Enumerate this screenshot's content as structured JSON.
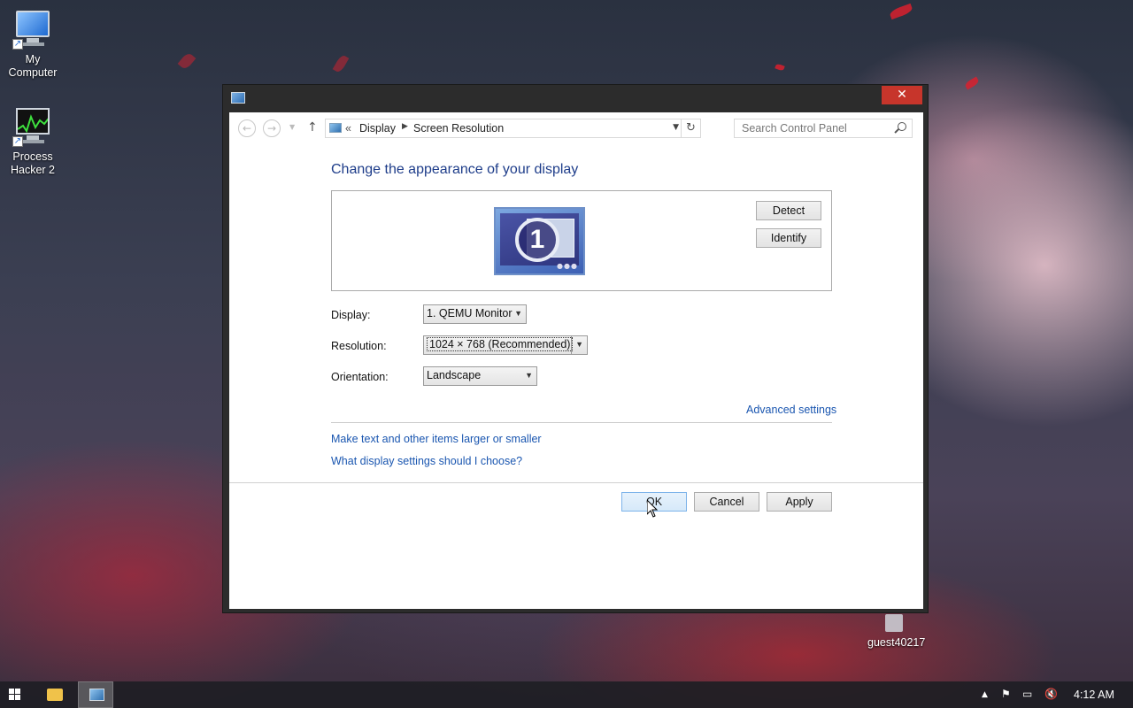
{
  "desktop": {
    "icons": [
      {
        "label_line1": "My",
        "label_line2": "Computer"
      },
      {
        "label_line1": "Process",
        "label_line2": "Hacker 2"
      }
    ],
    "user_label": "guest40217"
  },
  "window": {
    "close_label": "✕",
    "nav": {
      "back_label": "←",
      "forward_label": "→",
      "up_label": "↑",
      "breadcrumb_prefix": "«",
      "breadcrumb": [
        "Display",
        "Screen Resolution"
      ],
      "refresh_label": "↻",
      "search_placeholder": "Search Control Panel"
    },
    "heading": "Change the appearance of your display",
    "monitor_number": "1",
    "detect_label": "Detect",
    "identify_label": "Identify",
    "fields": {
      "display": {
        "label": "Display:",
        "value": "1. QEMU Monitor"
      },
      "resolution": {
        "label": "Resolution:",
        "value": "1024 × 768 (Recommended)"
      },
      "orientation": {
        "label": "Orientation:",
        "value": "Landscape"
      }
    },
    "advanced_link": "Advanced settings",
    "links": [
      "Make text and other items larger or smaller",
      "What display settings should I choose?"
    ],
    "ok_label": "OK",
    "cancel_label": "Cancel",
    "apply_label": "Apply"
  },
  "taskbar": {
    "clock": "4:12 AM",
    "tray_icons": [
      "chevron-up-icon",
      "flag-icon",
      "network-icon",
      "volume-muted-icon"
    ]
  }
}
